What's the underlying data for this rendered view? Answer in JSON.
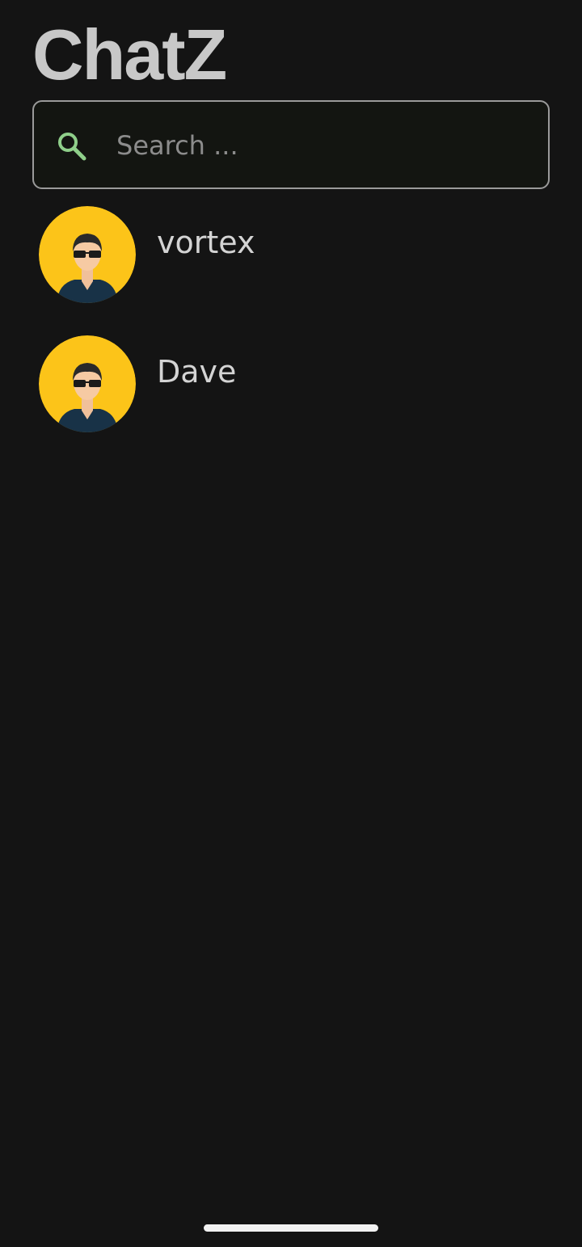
{
  "app": {
    "title": "ChatZ"
  },
  "search": {
    "placeholder": "Search ...",
    "value": "",
    "icon": "search-icon",
    "icon_color": "#8fcf8a"
  },
  "chats": [
    {
      "name": "vortex",
      "avatar": "avatar-man-sunglasses"
    },
    {
      "name": "Dave",
      "avatar": "avatar-man-sunglasses"
    }
  ],
  "colors": {
    "background": "#141414",
    "avatar_bg": "#fcc419",
    "text": "#d4d4d4",
    "title": "#c8c8c8"
  }
}
